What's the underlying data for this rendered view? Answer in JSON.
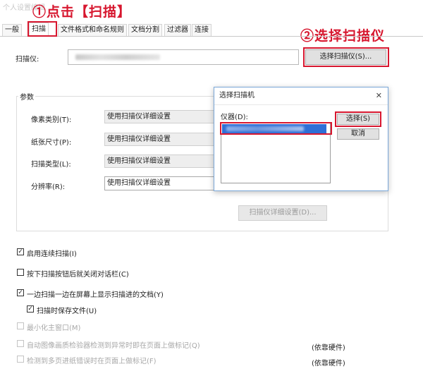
{
  "window": {
    "title": "个人设置编辑"
  },
  "annotations": {
    "step1": "①点击【扫描】",
    "step2": "②选择扫描仪",
    "color": "#d7172f"
  },
  "tabs": [
    {
      "label": "一般"
    },
    {
      "label": "扫描",
      "active": true
    },
    {
      "label": "文件格式和命名规则"
    },
    {
      "label": "文档分割"
    },
    {
      "label": "过滤器"
    },
    {
      "label": "连接"
    }
  ],
  "scanner": {
    "label": "扫描仪:",
    "value": "",
    "select_button": "选择扫描仪(S)..."
  },
  "params": {
    "legend": "参数",
    "rows": [
      {
        "label": "像素类别(T):",
        "value": "使用扫描仪详细设置"
      },
      {
        "label": "纸张尺寸(P):",
        "value": "使用扫描仪详细设置"
      },
      {
        "label": "扫描类型(L):",
        "value": "使用扫描仪详细设置"
      },
      {
        "label": "分辨率(R):",
        "value": "使用扫描仪详细设置"
      }
    ],
    "detail_button": "扫描仪详细设置(D)..."
  },
  "options": [
    {
      "label": "启用连续扫描(I)",
      "checked": true,
      "enabled": true
    },
    {
      "label": "按下扫描按钮后就关闭对话栏(C)",
      "checked": false,
      "enabled": true
    },
    {
      "label": "一边扫描一边在屏幕上显示扫描进的文档(Y)",
      "checked": true,
      "enabled": true
    },
    {
      "label": "扫描时保存文件(U)",
      "checked": true,
      "enabled": true
    },
    {
      "label": "最小化主窗口(M)",
      "checked": false,
      "enabled": false
    },
    {
      "label": "自动图像画质检验器检测到异常时即在页面上做标记(Q)",
      "checked": false,
      "enabled": false,
      "note": "(依靠硬件)"
    },
    {
      "label": "检测到多页进纸错误时在页面上做标记(F)",
      "checked": false,
      "enabled": false,
      "note": "(依靠硬件)"
    }
  ],
  "dialog": {
    "title": "选择扫描机",
    "close_glyph": "✕",
    "list_label": "仪器(D):",
    "select_button": "选择(S)",
    "cancel_button": "取消"
  },
  "colors": {
    "highlight": "#d7172f",
    "selection": "#2f6fd6",
    "dialog_border": "#7aa7d8"
  }
}
